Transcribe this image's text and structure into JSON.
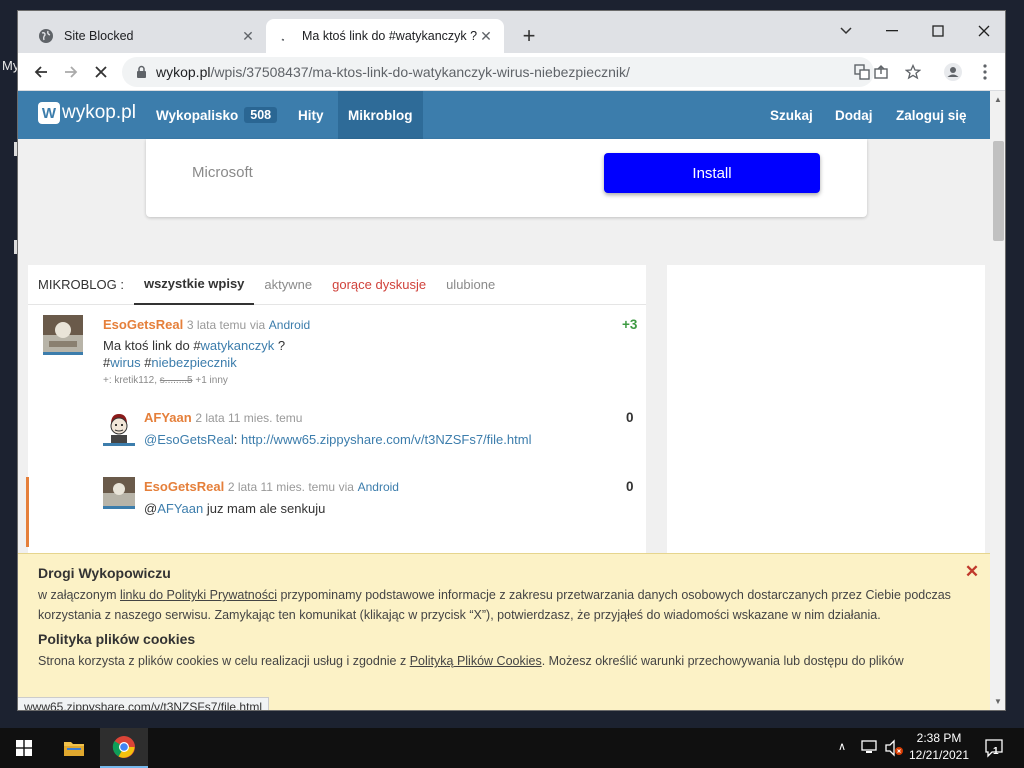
{
  "desktop": {
    "label": "My"
  },
  "browser": {
    "tabs": [
      {
        "title": "Site Blocked",
        "active": false,
        "icon": "globe-icon"
      },
      {
        "title": "Ma ktoś link do #watykanczyk ?",
        "active": true,
        "icon": "loading-icon"
      }
    ],
    "address": {
      "domain": "wykop.pl",
      "path": "/wpis/37508437/ma-ktos-link-do-watykanczyk-wirus-niebezpiecznik/"
    }
  },
  "wykop": {
    "logo": "wykop.pl",
    "nav": {
      "wykopalisko": "Wykopalisko",
      "wykopalisko_count": "508",
      "hity": "Hity",
      "mikroblog": "Mikroblog",
      "szukaj": "Szukaj",
      "dodaj": "Dodaj",
      "zaloguj": "Zaloguj się"
    },
    "ad": {
      "brand": "Microsoft",
      "button": "Install",
      "button_color": "#0000ff"
    },
    "mikroblog": {
      "title": "MIKROBLOG :",
      "tabs": [
        "wszystkie wpisy",
        "aktywne",
        "gorące dyskusje",
        "ulubione"
      ],
      "post": {
        "author": "EsoGetsReal",
        "time": "3 lata temu",
        "via": "via",
        "client": "Android",
        "score": "+3",
        "text_prefix": "Ma ktoś link do #",
        "tag1": "watykanczyk",
        "text_q": " ?",
        "hash1": "#",
        "tag2": "wirus",
        "hash2": " #",
        "tag3": "niebezpiecznik",
        "plus_prefix": "+: kretik112,",
        "plus_user": "s........5",
        "plus_more": "+1 inny"
      },
      "comments": [
        {
          "author": "AFYaan",
          "time": "2 lata 11 mies. temu",
          "score": "0",
          "mention": "@EsoGetsReal",
          "link": "http://www65.zippyshare.com/v/t3NZSFs7/file.html"
        },
        {
          "author": "EsoGetsReal",
          "time": "2 lata 11 mies. temu",
          "via": "via",
          "client": "Android",
          "score": "0",
          "mention": "@",
          "mention_user": "AFYaan",
          "text": " juz mam ale senkuju"
        }
      ]
    },
    "cookie": {
      "title": "Drogi Wykopowiczu",
      "p1_pre": "w załączonym ",
      "p1_link": "linku do Polityki Prywatności",
      "p1_post": " przypominamy podstawowe informacje z zakresu przetwarzania danych osobowych dostarczanych przez Ciebie podczas korzystania z naszego serwisu. Zamykając ten komunikat (klikając w przycisk “X”), potwierdzasz, że przyjąłeś do wiadomości wskazane w nim działania.",
      "title2": "Polityka plików cookies",
      "p2_pre": "Strona korzysta z plików cookies w celu realizacji usług i zgodnie z ",
      "p2_link": "Polityką Plików Cookies",
      "p2_post": ". Możesz określić warunki przechowywania lub dostępu do plików"
    },
    "status_url": "www65.zippyshare.com/v/t3NZSFs7/file.html"
  },
  "taskbar": {
    "time": "2:38 PM",
    "date": "12/21/2021",
    "notifications": "1"
  }
}
